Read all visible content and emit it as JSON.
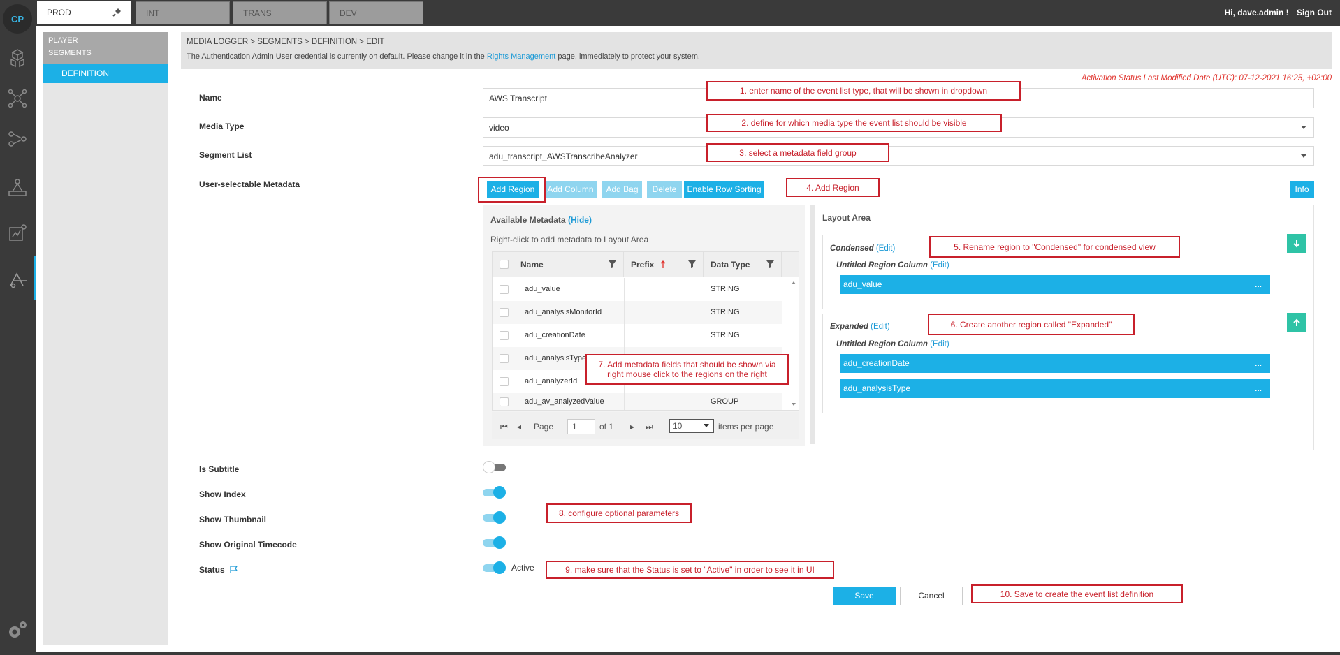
{
  "app": {
    "logo": "CP"
  },
  "env_tabs": [
    {
      "label": "PROD",
      "active": true
    },
    {
      "label": "INT",
      "active": false
    },
    {
      "label": "TRANS",
      "active": false
    },
    {
      "label": "DEV",
      "active": false
    }
  ],
  "user": {
    "greeting": "Hi, dave.admin !",
    "signout": "Sign Out"
  },
  "rail_icons": [
    "cubes-icon",
    "network-icon",
    "share-nodes-icon",
    "workflow-icon",
    "dashboard-icon",
    "media-logger-icon",
    "settings-icon"
  ],
  "subnav": {
    "group": [
      "PLAYER",
      "SEGMENTS"
    ],
    "selected": "DEFINITION"
  },
  "breadcrumb": {
    "path": "MEDIA LOGGER > SEGMENTS > DEFINITION > EDIT",
    "warn_pre": "The Authentication Admin User credential is currently on default. Please change it in the ",
    "warn_link": "Rights Management",
    "warn_post": " page, immediately to protect your system."
  },
  "activation": "Activation Status Last Modified Date (UTC): 07-12-2021 16:25, +02:00",
  "form": {
    "name_label": "Name",
    "name_value": "AWS Transcript",
    "media_type_label": "Media Type",
    "media_type_value": "video",
    "segment_list_label": "Segment List",
    "segment_list_value": "adu_transcript_AWSTranscribeAnalyzer",
    "metadata_label": "User-selectable Metadata",
    "is_subtitle_label": "Is Subtitle",
    "show_index_label": "Show Index",
    "show_thumbnail_label": "Show Thumbnail",
    "show_timecode_label": "Show Original Timecode",
    "status_label": "Status",
    "status_value": "Active",
    "toggles": {
      "is_subtitle": false,
      "show_index": true,
      "show_thumbnail": true,
      "show_timecode": true,
      "status": true
    }
  },
  "toolbar": {
    "add_region": "Add Region",
    "add_column": "Add Column",
    "add_bag": "Add Bag",
    "delete": "Delete",
    "enable_sorting": "Enable Row Sorting",
    "info": "Info"
  },
  "available": {
    "title": "Available Metadata",
    "hide": "(Hide)",
    "hint": "Right-click to add metadata to Layout Area",
    "columns": [
      "Name",
      "Prefix",
      "Data Type"
    ],
    "rows": [
      {
        "name": "adu_value",
        "prefix": "",
        "type": "STRING"
      },
      {
        "name": "adu_analysisMonitorId",
        "prefix": "",
        "type": "STRING"
      },
      {
        "name": "adu_creationDate",
        "prefix": "",
        "type": "STRING"
      },
      {
        "name": "adu_analysisType",
        "prefix": "",
        "type": ""
      },
      {
        "name": "adu_analyzerId",
        "prefix": "",
        "type": ""
      },
      {
        "name": "adu_av_analyzedValue",
        "prefix": "",
        "type": "GROUP"
      }
    ],
    "pager": {
      "page_label": "Page",
      "page": "1",
      "of": "of 1",
      "per_page": "10",
      "per_page_label": "items per page"
    }
  },
  "layout": {
    "title": "Layout Area",
    "regions": [
      {
        "name": "Condensed",
        "edit": "(Edit)",
        "column": "Untitled Region Column",
        "fields": [
          "adu_value"
        ]
      },
      {
        "name": "Expanded",
        "edit": "(Edit)",
        "column": "Untitled Region Column",
        "fields": [
          "adu_creationDate",
          "adu_analysisType"
        ]
      }
    ],
    "dots": "..."
  },
  "annotations": [
    "1. enter name of the event list type, that will be shown in dropdown",
    "2. define for which media type the event list should be visible",
    "3. select a metadata field group",
    "4. Add Region",
    "5. Rename region to \"Condensed\" for condensed view",
    "6. Create another region called \"Expanded\"",
    "7. Add metadata fields that should be shown via right mouse click to the regions on the right",
    "8. configure optional parameters",
    "9. make sure that the Status is set to \"Active\" in order to see it in UI",
    "10. Save to create the event list definition"
  ],
  "actions": {
    "save": "Save",
    "cancel": "Cancel"
  },
  "colors": {
    "accent": "#1cb0e6",
    "annotation": "#c8202b",
    "rail": "#3a3a3a",
    "success": "#2fc3a6"
  }
}
